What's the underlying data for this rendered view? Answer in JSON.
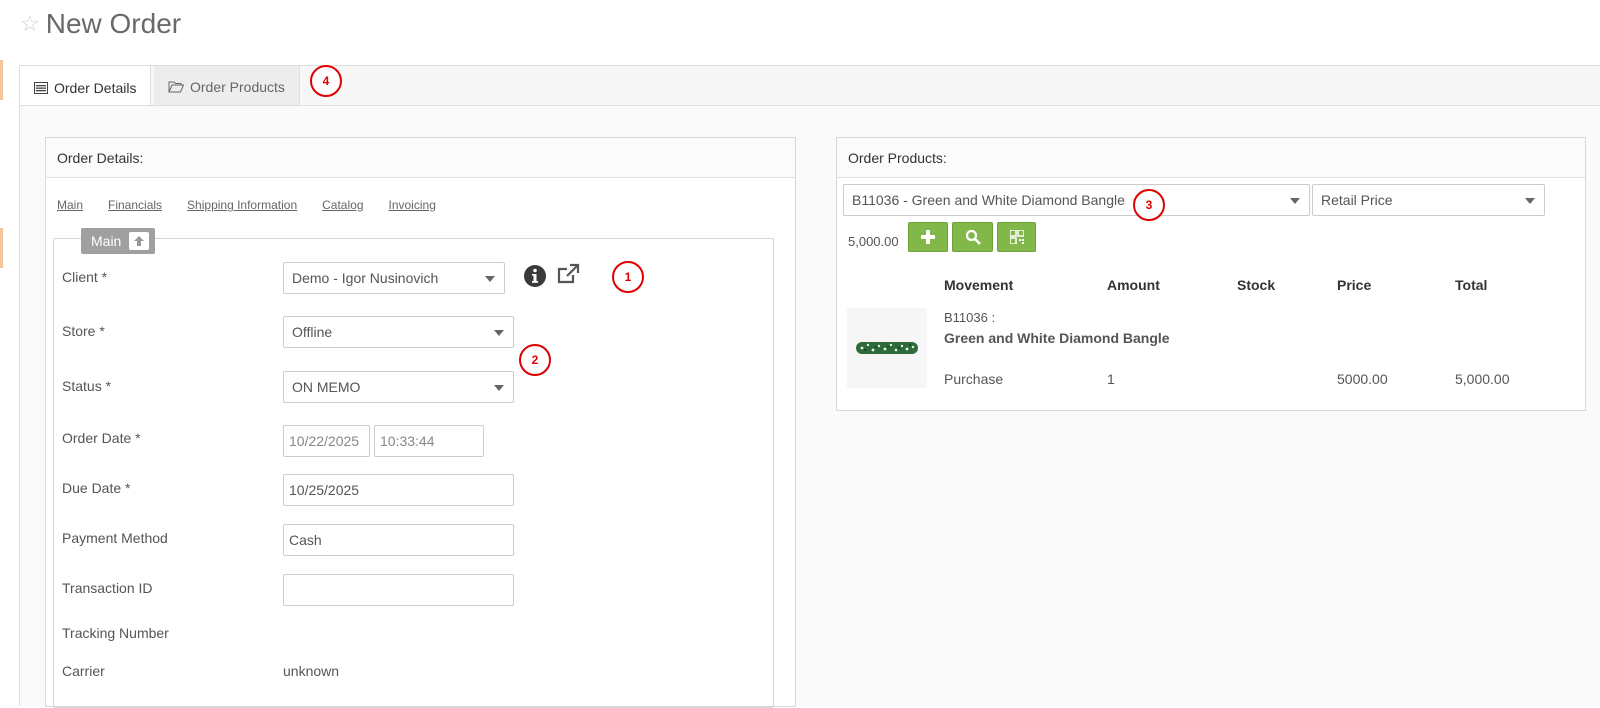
{
  "page": {
    "title": "New Order",
    "favorite_icon": "star-icon"
  },
  "tabs": [
    {
      "label": "Order Details",
      "icon": "list-icon",
      "active": true
    },
    {
      "label": "Order Products",
      "icon": "folder-open-icon",
      "active": false
    }
  ],
  "order_details": {
    "heading": "Order Details:",
    "sub_links": [
      "Main",
      "Financials",
      "Shipping Information",
      "Catalog",
      "Invoicing"
    ],
    "section_toggle_label": "Main",
    "fields": {
      "client": {
        "label": "Client *",
        "value": "Demo - Igor Nusinovich"
      },
      "store": {
        "label": "Store *",
        "value": "Offline"
      },
      "status": {
        "label": "Status *",
        "value": "ON MEMO"
      },
      "order_date": {
        "label": "Order Date *",
        "date": "10/22/2025",
        "time": "10:33:44"
      },
      "due_date": {
        "label": "Due Date *",
        "value": "10/25/2025"
      },
      "payment_method": {
        "label": "Payment Method",
        "value": "Cash"
      },
      "transaction_id": {
        "label": "Transaction ID",
        "value": ""
      },
      "tracking_number": {
        "label": "Tracking Number",
        "value": ""
      },
      "carrier": {
        "label": "Carrier",
        "value": "unknown"
      }
    }
  },
  "order_products": {
    "heading": "Order Products:",
    "product_select": "B11036 - Green and White Diamond Bangle",
    "price_type_select": "Retail Price",
    "subtotal": "5,000.00",
    "columns": [
      "Movement",
      "Amount",
      "Stock",
      "Price",
      "Total"
    ],
    "items": [
      {
        "code": "B11036 :",
        "name": "Green and White Diamond Bangle",
        "movement": "Purchase",
        "amount": "1",
        "stock": "",
        "price": "5000.00",
        "total": "5,000.00"
      }
    ]
  },
  "annotations": [
    "1",
    "2",
    "3",
    "4"
  ],
  "colors": {
    "accent_green": "#82b74a",
    "annotation_red": "#e00000",
    "edge_marker": "#f4c49a"
  }
}
